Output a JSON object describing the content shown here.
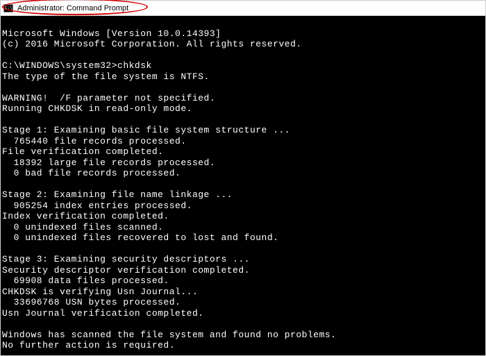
{
  "titlebar": {
    "title": "Administrator: Command Prompt"
  },
  "terminal": {
    "prompt": "C:\\WINDOWS\\system32>",
    "command": "chkdsk",
    "lines": [
      "Microsoft Windows [Version 10.0.14393]",
      "(c) 2016 Microsoft Corporation. All rights reserved.",
      "",
      "C:\\WINDOWS\\system32>chkdsk",
      "The type of the file system is NTFS.",
      "",
      "WARNING!  /F parameter not specified.",
      "Running CHKDSK in read-only mode.",
      "",
      "Stage 1: Examining basic file system structure ...",
      "  765440 file records processed.",
      "File verification completed.",
      "  18392 large file records processed.",
      "  0 bad file records processed.",
      "",
      "Stage 2: Examining file name linkage ...",
      "  905254 index entries processed.",
      "Index verification completed.",
      "  0 unindexed files scanned.",
      "  0 unindexed files recovered to lost and found.",
      "",
      "Stage 3: Examining security descriptors ...",
      "Security descriptor verification completed.",
      "  69908 data files processed.",
      "CHKDSK is verifying Usn Journal...",
      "  33696768 USN bytes processed.",
      "Usn Journal verification completed.",
      "",
      "Windows has scanned the file system and found no problems.",
      "No further action is required."
    ]
  }
}
